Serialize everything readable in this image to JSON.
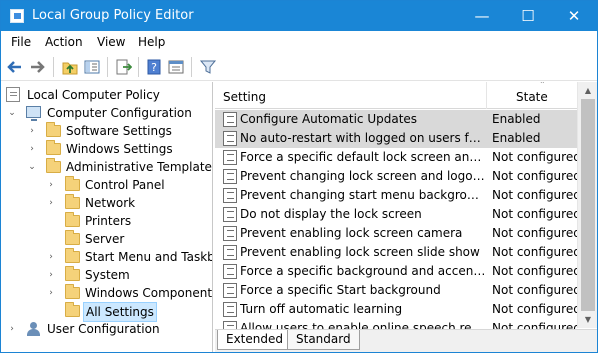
{
  "window": {
    "title": "Local Group Policy Editor",
    "minimize_glyph": "—",
    "maximize_glyph": "☐",
    "close_glyph": "✕"
  },
  "menu": [
    "File",
    "Action",
    "View",
    "Help"
  ],
  "toolbar": {
    "buttons": [
      "back-icon",
      "forward-icon",
      "up-folder-icon",
      "show-hide-tree-icon",
      "export-list-icon",
      "help-icon",
      "properties-icon",
      "filter-icon"
    ]
  },
  "tree": [
    {
      "label": "Local Computer Policy",
      "icon": "policy-icon",
      "expanded": true
    },
    {
      "label": "Computer Configuration",
      "icon": "computer-icon",
      "expanded": true
    },
    {
      "label": "Software Settings",
      "icon": "folder-icon",
      "expanded": false
    },
    {
      "label": "Windows Settings",
      "icon": "folder-icon",
      "expanded": false
    },
    {
      "label": "Administrative Templates",
      "icon": "folder-icon",
      "expanded": true
    },
    {
      "label": "Control Panel",
      "icon": "folder-icon",
      "expanded": false
    },
    {
      "label": "Network",
      "icon": "folder-icon",
      "expanded": false
    },
    {
      "label": "Printers",
      "icon": "folder-icon",
      "expanded": false
    },
    {
      "label": "Server",
      "icon": "folder-icon",
      "expanded": false
    },
    {
      "label": "Start Menu and Taskbar",
      "icon": "folder-icon",
      "expanded": false
    },
    {
      "label": "System",
      "icon": "folder-icon",
      "expanded": false
    },
    {
      "label": "Windows Components",
      "icon": "folder-icon",
      "expanded": false
    },
    {
      "label": "All Settings",
      "icon": "folder-icon",
      "expanded": false,
      "selected": true
    },
    {
      "label": "User Configuration",
      "icon": "user-icon",
      "expanded": false
    }
  ],
  "list": {
    "columns": [
      "Setting",
      "State"
    ],
    "rows": [
      {
        "setting": "Configure Automatic Updates",
        "state": "Enabled"
      },
      {
        "setting": "No auto-restart with logged on users for sch...",
        "state": "Enabled"
      },
      {
        "setting": "Force a specific default lock screen and logo...",
        "state": "Not configured"
      },
      {
        "setting": "Prevent changing lock screen and logon ima...",
        "state": "Not configured"
      },
      {
        "setting": "Prevent changing start menu background",
        "state": "Not configured"
      },
      {
        "setting": "Do not display the lock screen",
        "state": "Not configured"
      },
      {
        "setting": "Prevent enabling lock screen camera",
        "state": "Not configured"
      },
      {
        "setting": "Prevent enabling lock screen slide show",
        "state": "Not configured"
      },
      {
        "setting": "Force a specific background and accent color",
        "state": "Not configured"
      },
      {
        "setting": "Force a specific Start background",
        "state": "Not configured"
      },
      {
        "setting": "Turn off automatic learning",
        "state": "Not configured"
      },
      {
        "setting": "Allow users to enable online speech recogni...",
        "state": "Not configured"
      }
    ]
  },
  "tabs": [
    "Extended",
    "Standard"
  ],
  "colors": {
    "titlebar": "#1a86d6",
    "enabled_highlight": "#d9d9d9",
    "selected_tree": "#cce8ff"
  }
}
